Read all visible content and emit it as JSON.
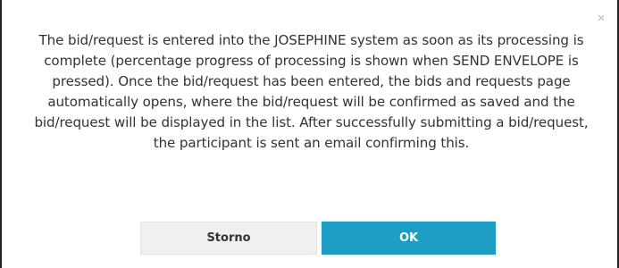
{
  "dialog": {
    "message": "The bid/request is entered into the JOSEPHINE system as soon as its processing is complete (percentage progress of processing is shown when SEND ENVELOPE is pressed). Once the bid/request has been entered, the bids and requests page automatically opens, where the bid/request will be confirmed as saved and the bid/request will be displayed in the list. After successfully submitting a bid/request, the participant is sent an email confirming this.",
    "close_icon": "close-icon",
    "buttons": {
      "cancel_label": "Storno",
      "ok_label": "OK"
    }
  },
  "colors": {
    "ok_button": "#1d9dc3",
    "cancel_button": "#f0f0f0",
    "text": "#333333",
    "border": "#222222"
  }
}
